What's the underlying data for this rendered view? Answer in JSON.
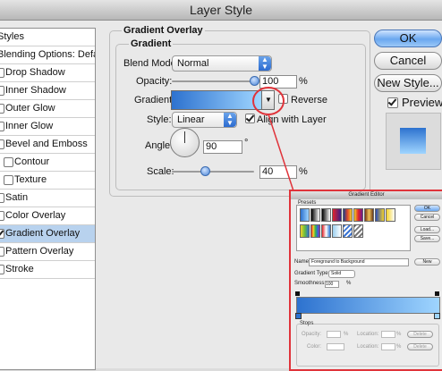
{
  "window": {
    "title": "Layer Style"
  },
  "sidebar": {
    "items": [
      {
        "label": "Styles",
        "checkbox": false,
        "checked": false
      },
      {
        "label": "Blending Options: Default",
        "checkbox": false,
        "checked": false
      },
      {
        "label": "Drop Shadow",
        "checkbox": true,
        "checked": false
      },
      {
        "label": "Inner Shadow",
        "checkbox": true,
        "checked": false
      },
      {
        "label": "Outer Glow",
        "checkbox": true,
        "checked": false
      },
      {
        "label": "Inner Glow",
        "checkbox": true,
        "checked": false
      },
      {
        "label": "Bevel and Emboss",
        "checkbox": true,
        "checked": false
      },
      {
        "label": "Contour",
        "checkbox": true,
        "checked": false
      },
      {
        "label": "Texture",
        "checkbox": true,
        "checked": false
      },
      {
        "label": "Satin",
        "checkbox": true,
        "checked": false
      },
      {
        "label": "Color Overlay",
        "checkbox": true,
        "checked": false
      },
      {
        "label": "Gradient Overlay",
        "checkbox": true,
        "checked": true,
        "selected": true
      },
      {
        "label": "Pattern Overlay",
        "checkbox": true,
        "checked": false
      },
      {
        "label": "Stroke",
        "checkbox": true,
        "checked": false
      }
    ]
  },
  "panel": {
    "section_title": "Gradient Overlay",
    "group_title": "Gradient",
    "blend_mode_label": "Blend Mode:",
    "blend_mode_value": "Normal",
    "opacity_label": "Opacity:",
    "opacity_value": "100",
    "opacity_unit": "%",
    "opacity_fraction": 1.0,
    "gradient_label": "Gradient:",
    "reverse_label": "Reverse",
    "reverse_checked": false,
    "style_label": "Style:",
    "style_value": "Linear",
    "align_label": "Align with Layer",
    "align_checked": true,
    "angle_label": "Angle:",
    "angle_value": "90",
    "angle_unit": "°",
    "scale_label": "Scale:",
    "scale_value": "40",
    "scale_unit": "%",
    "scale_fraction": 0.4
  },
  "buttons": {
    "ok": "OK",
    "cancel": "Cancel",
    "new_style": "New Style...",
    "preview_label": "Preview",
    "preview_checked": true
  },
  "gradient_editor": {
    "title": "Gradient Editor",
    "presets_label": "Presets",
    "ok": "OK",
    "cancel": "Cancel",
    "load": "Load...",
    "save": "Save...",
    "name_label": "Name:",
    "name_value": "Foreground to Background",
    "new_button": "New",
    "gradient_type_label": "Gradient Type:",
    "gradient_type_value": "Solid",
    "smoothness_label": "Smoothness:",
    "smoothness_value": "100",
    "smoothness_unit": "%",
    "stops_label": "Stops",
    "opacity_label": "Opacity:",
    "opacity_unit": "%",
    "location_label": "Location:",
    "location_unit": "%",
    "delete": "Delete",
    "color_label": "Color:"
  },
  "colors": {
    "accent": "#3b78d8",
    "selection": "#b8d2ee",
    "highlight_red": "#e0333a",
    "gradient_start": "#2d72cf",
    "gradient_end": "#9fd5ff"
  }
}
